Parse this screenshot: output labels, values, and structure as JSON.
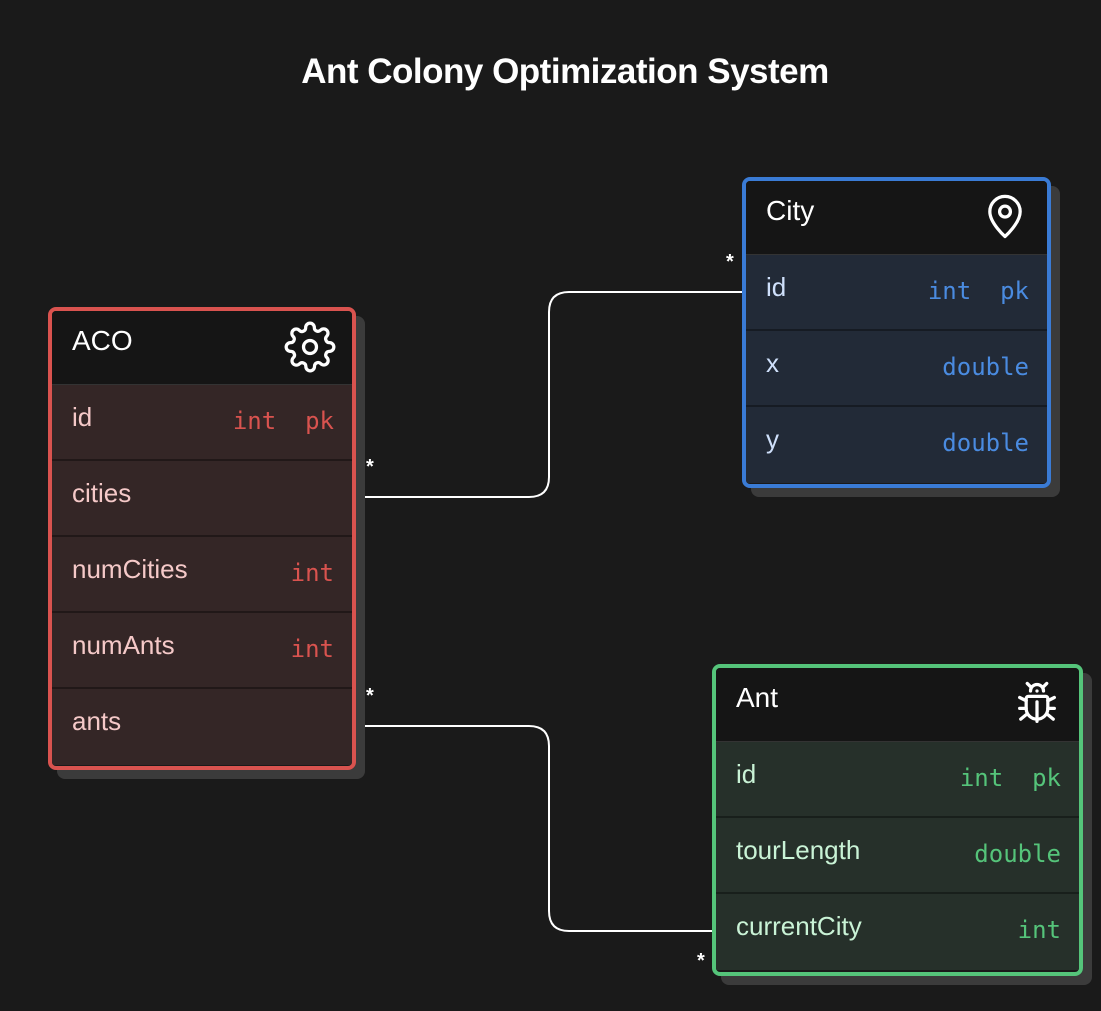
{
  "title": "Ant Colony Optimization System",
  "colors": {
    "aco": "#d9534f",
    "city": "#3a7bd5",
    "ant": "#55c47a",
    "background": "#1a1a1a"
  },
  "tables": {
    "aco": {
      "name": "ACO",
      "icon": "gear-icon",
      "fields": [
        {
          "name": "id",
          "type": "int  pk"
        },
        {
          "name": "cities",
          "type": ""
        },
        {
          "name": "numCities",
          "type": "int"
        },
        {
          "name": "numAnts",
          "type": "int"
        },
        {
          "name": "ants",
          "type": ""
        }
      ]
    },
    "city": {
      "name": "City",
      "icon": "map-pin-icon",
      "fields": [
        {
          "name": "id",
          "type": "int  pk"
        },
        {
          "name": "x",
          "type": "double"
        },
        {
          "name": "y",
          "type": "double"
        }
      ]
    },
    "ant": {
      "name": "Ant",
      "icon": "bug-icon",
      "fields": [
        {
          "name": "id",
          "type": "int  pk"
        },
        {
          "name": "tourLength",
          "type": "double"
        },
        {
          "name": "currentCity",
          "type": "int"
        }
      ]
    }
  },
  "relationships": [
    {
      "from": "ACO.cities",
      "to": "City.id",
      "from_cardinality": "*",
      "to_cardinality": "*"
    },
    {
      "from": "ACO.ants",
      "to": "Ant.currentCity",
      "from_cardinality": "*",
      "to_cardinality": "*"
    }
  ]
}
